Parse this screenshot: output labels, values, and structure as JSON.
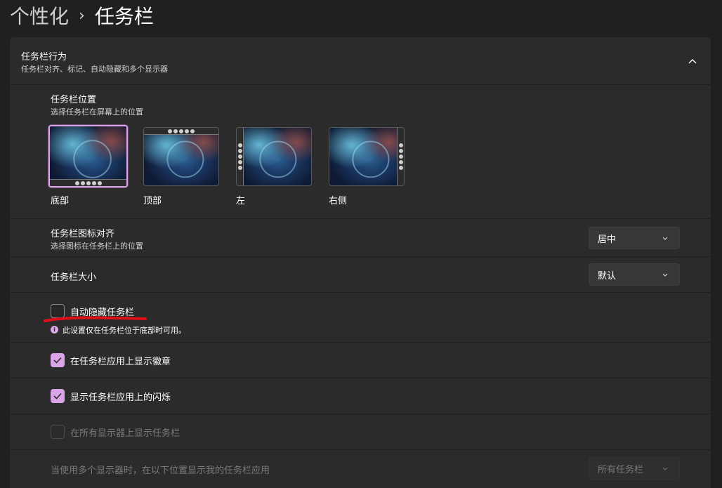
{
  "breadcrumb": {
    "parent": "个性化",
    "separator": "›",
    "current": "任务栏"
  },
  "section": {
    "title": "任务栏行为",
    "subtitle": "任务栏对齐、标记、自动隐藏和多个显示器"
  },
  "position": {
    "title": "任务栏位置",
    "subtitle": "选择任务栏在屏幕上的位置",
    "options": [
      {
        "label": "底部",
        "selected": true
      },
      {
        "label": "顶部",
        "selected": false
      },
      {
        "label": "左",
        "selected": false
      },
      {
        "label": "右侧",
        "selected": false
      }
    ]
  },
  "alignment": {
    "title": "任务栏图标对齐",
    "subtitle": "选择图标在任务栏上的位置",
    "value": "居中"
  },
  "size": {
    "title": "任务栏大小",
    "value": "默认"
  },
  "autohide": {
    "label": "自动隐藏任务栏",
    "checked": false,
    "note": "此设置仅在任务栏位于底部时可用。"
  },
  "badges": {
    "label": "在任务栏应用上显示徽章",
    "checked": true
  },
  "flashing": {
    "label": "显示任务栏应用上的闪烁",
    "checked": true
  },
  "all_displays": {
    "label": "在所有显示器上显示任务栏",
    "checked": false,
    "disabled": true
  },
  "multi_display": {
    "label": "当使用多个显示器时，在以下位置显示我的任务栏应用",
    "value": "所有任务栏",
    "disabled": true
  },
  "colors": {
    "accent": "#d9a5e6",
    "background": "#202020",
    "card": "#2b2b2b",
    "annotation": "#e0101a"
  }
}
